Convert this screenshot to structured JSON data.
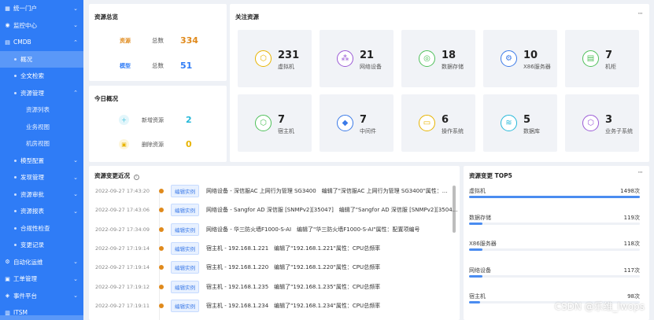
{
  "sidebar": {
    "items": [
      {
        "label": "统一门户",
        "icon": "portal-icon",
        "chevron": true,
        "level": 0
      },
      {
        "label": "监控中心",
        "icon": "monitor-icon",
        "chevron": true,
        "level": 0
      },
      {
        "label": "CMDB",
        "icon": "cmdb-icon",
        "chevron": true,
        "level": 0
      },
      {
        "label": "概况",
        "level": 1,
        "active": true
      },
      {
        "label": "全文检索",
        "level": 1
      },
      {
        "label": "资源管理",
        "level": 1,
        "chevron": true
      },
      {
        "label": "资源列表",
        "level": 2
      },
      {
        "label": "业务视图",
        "level": 2
      },
      {
        "label": "机房视图",
        "level": 2
      },
      {
        "label": "模型配置",
        "level": 1,
        "chevron": true
      },
      {
        "label": "发现管理",
        "level": 1,
        "chevron": true
      },
      {
        "label": "资源审批",
        "level": 1,
        "chevron": true
      },
      {
        "label": "资源报表",
        "level": 1,
        "chevron": true
      },
      {
        "label": "合规性检查",
        "level": 1
      },
      {
        "label": "变更记录",
        "level": 1
      },
      {
        "label": "自动化运维",
        "icon": "automation-icon",
        "chevron": true,
        "level": 0
      },
      {
        "label": "工单管理",
        "icon": "ticket-icon",
        "chevron": true,
        "level": 0
      },
      {
        "label": "事件平台",
        "icon": "event-icon",
        "chevron": true,
        "level": 0
      },
      {
        "label": "ITSM",
        "icon": "itsm-icon",
        "level": 0
      }
    ]
  },
  "overview": {
    "title": "资源总览",
    "rows": [
      {
        "tag": "资源",
        "label": "总数",
        "value": "334",
        "color": "#e08a1c"
      },
      {
        "tag": "模型",
        "label": "总数",
        "value": "51",
        "color": "#2f7cf6"
      }
    ]
  },
  "today": {
    "title": "今日概况",
    "rows": [
      {
        "label": "新增资源",
        "value": "2",
        "color": "#25b8d9",
        "icon": "plus-icon"
      },
      {
        "label": "删除资源",
        "value": "0",
        "color": "#e8b400",
        "icon": "delete-icon"
      }
    ]
  },
  "followed": {
    "title": "关注资源",
    "more": "···",
    "tiles": [
      {
        "value": "231",
        "label": "虚拟机",
        "color": "#e8b400",
        "icon": "cube-icon"
      },
      {
        "value": "21",
        "label": "网络设备",
        "color": "#9b59d6",
        "icon": "network-icon"
      },
      {
        "value": "18",
        "label": "数据存储",
        "color": "#4fc05a",
        "icon": "storage-icon"
      },
      {
        "value": "10",
        "label": "X86服务器",
        "color": "#3b7ae8",
        "icon": "server-icon"
      },
      {
        "value": "7",
        "label": "机柜",
        "color": "#4fc05a",
        "icon": "cabinet-icon"
      },
      {
        "value": "7",
        "label": "宿主机",
        "color": "#4fc05a",
        "icon": "host-icon"
      },
      {
        "value": "7",
        "label": "中间件",
        "color": "#3b7ae8",
        "icon": "middleware-icon"
      },
      {
        "value": "6",
        "label": "操作系统",
        "color": "#e8b400",
        "icon": "os-icon"
      },
      {
        "value": "5",
        "label": "数据库",
        "color": "#25b8d9",
        "icon": "database-icon"
      },
      {
        "value": "3",
        "label": "业务子系统",
        "color": "#9b59d6",
        "icon": "subsystem-icon"
      }
    ]
  },
  "changes": {
    "title": "资源变更近况",
    "info_icon": "info-icon",
    "rows": [
      {
        "time": "2022-09-27 17:43:20",
        "tag": "编辑实例",
        "text": "网络设备 - 深信服AC 上网行为管理 SG3400　编辑了\"深信服AC 上网行为管理 SG3400\"属性：..."
      },
      {
        "time": "2022-09-27 17:43:06",
        "tag": "编辑实例",
        "text": "网络设备 - Sangfor AD 深信服 [SNMPv2][35047]　编辑了\"Sangfor AD 深信服 [SNMPv2][35047..."
      },
      {
        "time": "2022-09-27 17:34:09",
        "tag": "编辑实例",
        "text": "网络设备 - 华三防火墙F1000-S-AI　编辑了\"华三防火墙F1000-S-AI\"属性：配置项编号"
      },
      {
        "time": "2022-09-27 17:19:14",
        "tag": "编辑实例",
        "text": "宿主机 - 192.168.1.221　编辑了\"192.168.1.221\"属性：CPU总频率"
      },
      {
        "time": "2022-09-27 17:19:14",
        "tag": "编辑实例",
        "text": "宿主机 - 192.168.1.220　编辑了\"192.168.1.220\"属性：CPU总频率"
      },
      {
        "time": "2022-09-27 17:19:12",
        "tag": "编辑实例",
        "text": "宿主机 - 192.168.1.235　编辑了\"192.168.1.235\"属性：CPU总频率"
      },
      {
        "time": "2022-09-27 17:19:11",
        "tag": "编辑实例",
        "text": "宿主机 - 192.168.1.234　编辑了\"192.168.1.234\"属性：CPU总频率"
      }
    ]
  },
  "tops": {
    "title": "资源变更 TOP5",
    "more": "···",
    "rows": [
      {
        "name": "虚拟机",
        "count": "1498次",
        "value": 1498
      },
      {
        "name": "数据存储",
        "count": "119次",
        "value": 119
      },
      {
        "name": "X86服务器",
        "count": "118次",
        "value": 118
      },
      {
        "name": "网络设备",
        "count": "117次",
        "value": 117
      },
      {
        "name": "宿主机",
        "count": "98次",
        "value": 98
      }
    ]
  },
  "watermark": "CSDN @乐维_lwops",
  "colors": {
    "sidebar": "#2f7cf6",
    "accent": "#3b7ae8",
    "timeline_dot": "#e08a1c",
    "bar": "#4a8cf0"
  }
}
